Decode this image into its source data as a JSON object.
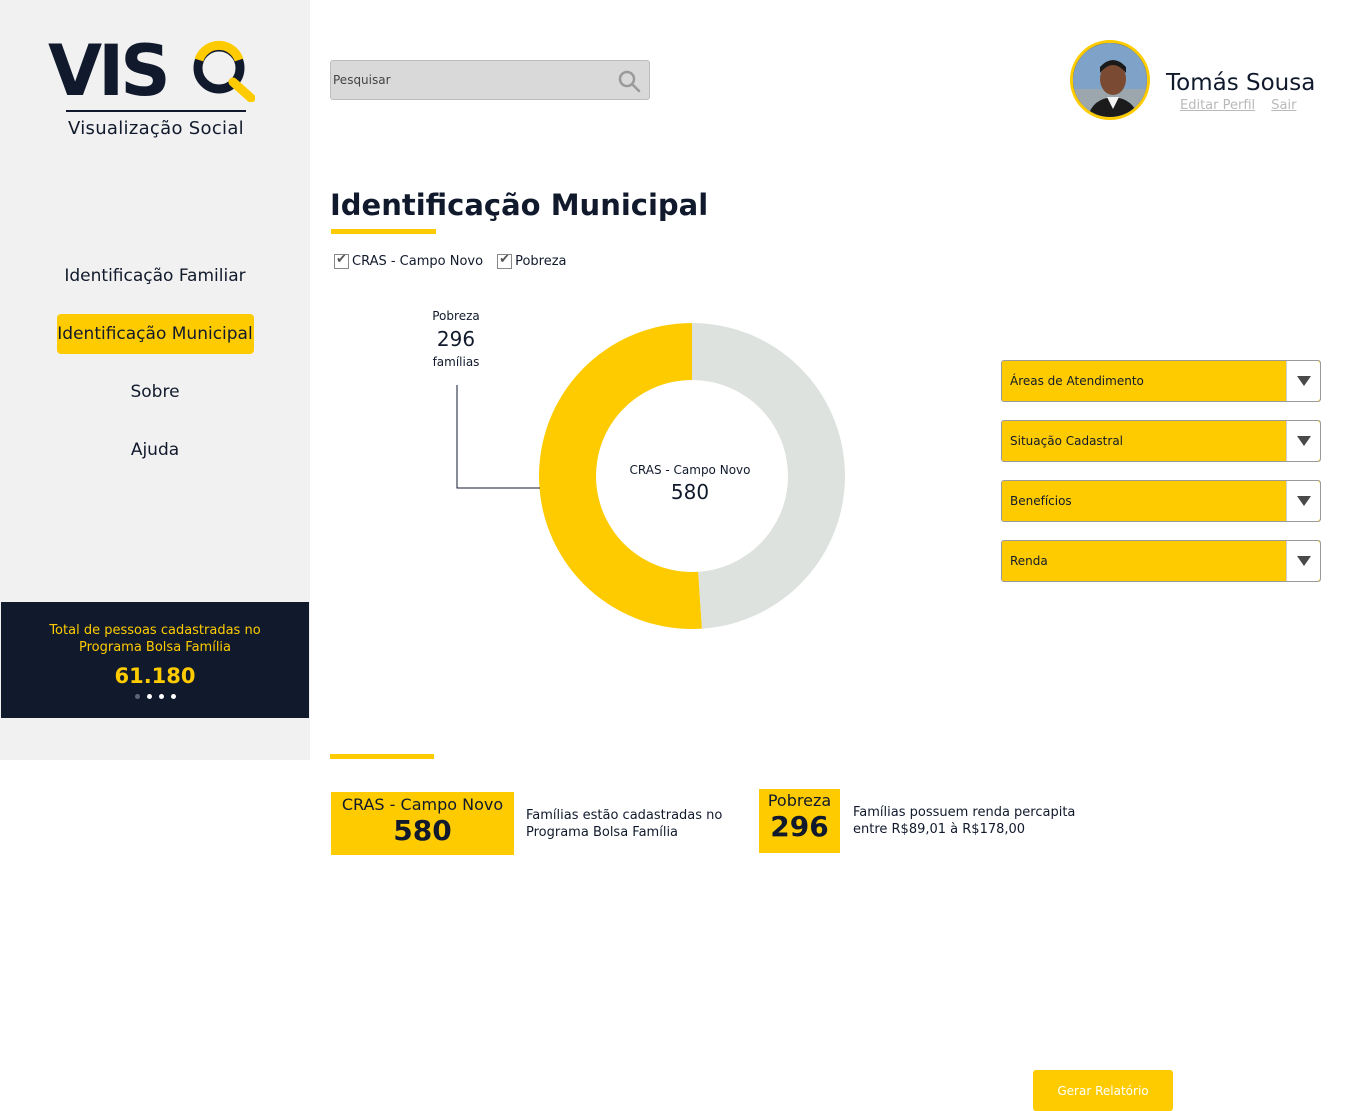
{
  "brand": {
    "logo_text": "VISQ",
    "tagline": "Visualização Social",
    "primary_color": "#fecb00",
    "dark_color": "#111a2c"
  },
  "sidebar": {
    "items": [
      {
        "label": "Identificação Familiar",
        "active": false
      },
      {
        "label": "Identificação Municipal",
        "active": true
      },
      {
        "label": "Sobre",
        "active": false
      },
      {
        "label": "Ajuda",
        "active": false
      }
    ],
    "stats": {
      "label": "Total de pessoas cadastradas no Programa Bolsa Família",
      "value": "61.180"
    }
  },
  "header": {
    "search_placeholder": "Pesquisar",
    "user_name": "Tomás Sousa",
    "edit_profile": "Editar Perfil",
    "logout": "Sair"
  },
  "main": {
    "title": "Identificação Municipal",
    "filters": [
      {
        "label": "CRAS - Campo Novo",
        "checked": true
      },
      {
        "label": "Pobreza",
        "checked": true
      }
    ],
    "dropdowns": [
      {
        "label": "Áreas de Atendimento"
      },
      {
        "label": "Situação Cadastral"
      },
      {
        "label": "Benefícios"
      },
      {
        "label": "Renda"
      }
    ],
    "summaries": [
      {
        "label": "CRAS - Campo Novo",
        "value": "580",
        "description": "Famílias estão cadastradas no Programa Bolsa Família"
      },
      {
        "label": "Pobreza",
        "value": "296",
        "description": "Famílias possuem renda percapita entre R$89,01 à R$178,00"
      }
    ],
    "report_button": "Gerar Relatório"
  },
  "chart_data": {
    "type": "pie",
    "center_label": "CRAS - Campo Novo",
    "center_value": "580",
    "total": 580,
    "slices": [
      {
        "name": "Pobreza",
        "value": 296,
        "color": "#fecb00"
      },
      {
        "value": 284,
        "color": "#dde2de"
      }
    ],
    "callout": {
      "label": "Pobreza",
      "value": "296",
      "unit": "famílias"
    }
  }
}
